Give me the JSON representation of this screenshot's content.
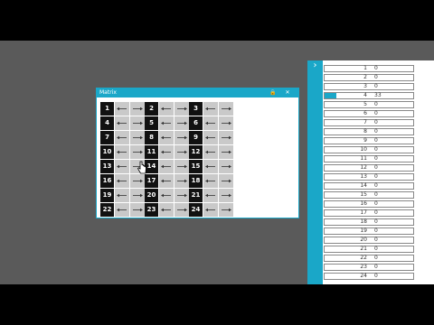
{
  "window": {
    "title": "Matrix",
    "pin_label": "🔒",
    "close_label": "✕"
  },
  "matrix": {
    "cells": [
      "1",
      "2",
      "3",
      "4",
      "5",
      "6",
      "7",
      "8",
      "9",
      "10",
      "11",
      "12",
      "13",
      "14",
      "15",
      "16",
      "17",
      "18",
      "19",
      "20",
      "21",
      "22",
      "23",
      "24"
    ]
  },
  "panel": {
    "toggle_label": "›",
    "rows": [
      {
        "index": "1",
        "value": "0",
        "level": 0
      },
      {
        "index": "2",
        "value": "0",
        "level": 0
      },
      {
        "index": "3",
        "value": "0",
        "level": 0
      },
      {
        "index": "4",
        "value": "33",
        "level": 0.13
      },
      {
        "index": "5",
        "value": "0",
        "level": 0
      },
      {
        "index": "6",
        "value": "0",
        "level": 0
      },
      {
        "index": "7",
        "value": "0",
        "level": 0
      },
      {
        "index": "8",
        "value": "0",
        "level": 0
      },
      {
        "index": "9",
        "value": "0",
        "level": 0
      },
      {
        "index": "10",
        "value": "0",
        "level": 0
      },
      {
        "index": "11",
        "value": "0",
        "level": 0
      },
      {
        "index": "12",
        "value": "0",
        "level": 0
      },
      {
        "index": "13",
        "value": "0",
        "level": 0
      },
      {
        "index": "14",
        "value": "0",
        "level": 0
      },
      {
        "index": "15",
        "value": "0",
        "level": 0
      },
      {
        "index": "16",
        "value": "0",
        "level": 0
      },
      {
        "index": "17",
        "value": "0",
        "level": 0
      },
      {
        "index": "18",
        "value": "0",
        "level": 0
      },
      {
        "index": "19",
        "value": "0",
        "level": 0
      },
      {
        "index": "20",
        "value": "0",
        "level": 0
      },
      {
        "index": "21",
        "value": "0",
        "level": 0
      },
      {
        "index": "22",
        "value": "0",
        "level": 0
      },
      {
        "index": "23",
        "value": "0",
        "level": 0
      },
      {
        "index": "24",
        "value": "0",
        "level": 0
      }
    ]
  },
  "colors": {
    "accent": "#1aa7c8",
    "desktop": "#5a5a5a",
    "cell_number_bg": "#111111",
    "arrow_bg": "#c9c9c9"
  },
  "icons": {
    "arrow_left": "arrow-left-icon",
    "arrow_right": "arrow-right-icon",
    "cursor": "hand-cursor-icon"
  }
}
